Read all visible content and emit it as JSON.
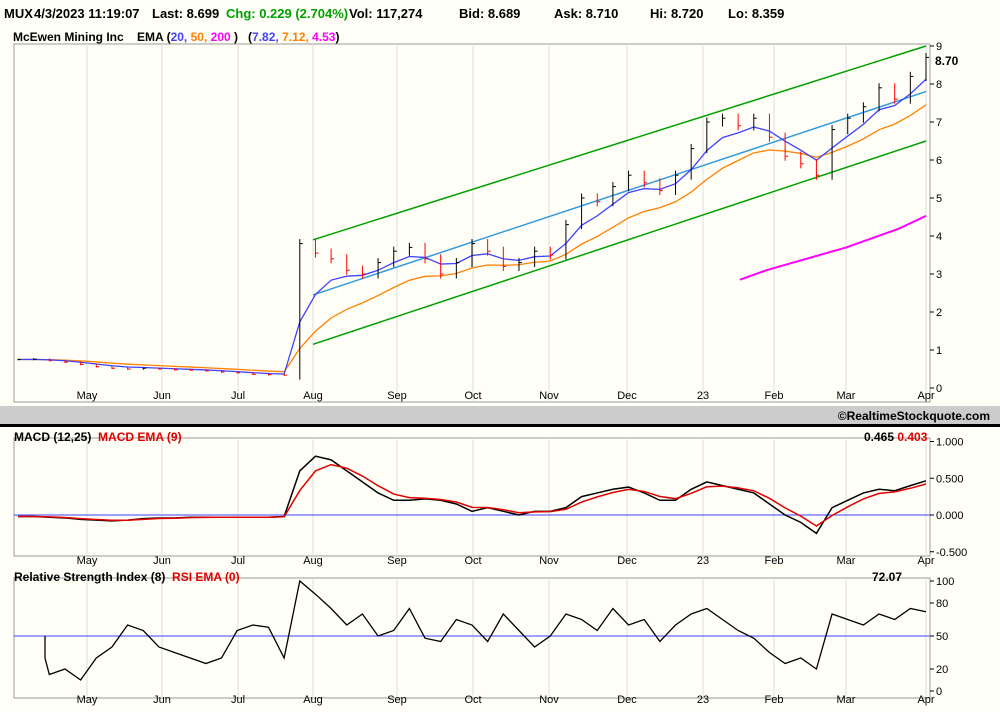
{
  "header": {
    "symbol": "MUX",
    "datetime": "4/3/2023 11:19:07",
    "last": "Last: 8.699",
    "chg": "Chg: 0.229 (2.704%)",
    "vol": "Vol: 117,274",
    "bid": "Bid: 8.689",
    "ask": "Ask: 8.710",
    "hi": "Hi: 8.720",
    "lo": "Lo: 8.359"
  },
  "price_panel": {
    "name": "McEwen Mining Inc",
    "ema_label": "EMA (",
    "ema_periods": [
      "20,",
      "50,",
      "200"
    ],
    "ema_close": ")",
    "ema_vals_open": "(",
    "ema_values": [
      "7.82,",
      "7.12,",
      "4.53"
    ],
    "ema_vals_close": ")",
    "last_tag": "8.70"
  },
  "copyright": "©RealtimeStockquote.com",
  "macd_panel": {
    "label": "MACD (12,25)",
    "signal_label": "MACD EMA (9)",
    "value": "0.465",
    "signal_value": "0.403"
  },
  "rsi_panel": {
    "label": "Relative Strength Index (8)",
    "ema_label": "RSI EMA (0)",
    "value": "72.07"
  },
  "colors": {
    "ema20": "#4040ff",
    "ema50": "#ff8000",
    "ema200": "#ff00ff",
    "channel": "#00a000",
    "midline": "#3399dd",
    "up": "#000000",
    "down": "#ff0000",
    "macd_signal": "#e00000"
  },
  "chart_data": [
    {
      "type": "line",
      "title": "McEwen Mining Inc",
      "ylabel": "Price",
      "ylim": [
        0,
        9
      ],
      "yticks": [
        "0",
        "1",
        "2",
        "3",
        "4",
        "5",
        "6",
        "7",
        "8",
        "9"
      ],
      "xticks": [
        "May",
        "Jun",
        "Jul",
        "Aug",
        "Sep",
        "Oct",
        "Nov",
        "Dec",
        "23",
        "Feb",
        "Mar",
        "Apr"
      ],
      "close": [
        0.75,
        0.76,
        0.72,
        0.68,
        0.62,
        0.56,
        0.52,
        0.5,
        0.52,
        0.5,
        0.48,
        0.47,
        0.45,
        0.42,
        0.4,
        0.36,
        0.35,
        0.34,
        3.8,
        3.55,
        3.4,
        3.1,
        3.0,
        3.3,
        3.6,
        3.7,
        3.4,
        3.0,
        3.3,
        3.8,
        3.6,
        3.2,
        3.3,
        3.6,
        3.5,
        4.3,
        5.0,
        4.9,
        5.3,
        5.6,
        5.4,
        5.2,
        5.6,
        6.3,
        7.0,
        7.1,
        6.9,
        7.1,
        6.6,
        6.1,
        5.9,
        5.6,
        6.8,
        7.1,
        7.4,
        7.9,
        7.6,
        8.2,
        8.7
      ],
      "ema200": [
        2.85,
        3.1,
        3.3,
        3.5,
        3.7,
        3.95,
        4.2,
        4.53
      ],
      "trendlines": [
        {
          "name": "upper-channel",
          "from": [
            "Aug",
            3.9
          ],
          "to": [
            "Apr",
            9.0
          ]
        },
        {
          "name": "mid-line",
          "from": [
            "Aug",
            2.45
          ],
          "to": [
            "Apr",
            7.8
          ]
        },
        {
          "name": "lower-channel",
          "from": [
            "Aug",
            1.15
          ],
          "to": [
            "Apr",
            6.5
          ]
        }
      ]
    },
    {
      "type": "line",
      "title": "MACD (12,25)",
      "ylim": [
        -0.5,
        1.0
      ],
      "yticks": [
        "1.000",
        "0.500",
        "0.000",
        "-0.500"
      ],
      "macd": [
        -0.02,
        -0.02,
        -0.03,
        -0.04,
        -0.06,
        -0.07,
        -0.08,
        -0.07,
        -0.05,
        -0.04,
        -0.04,
        -0.03,
        -0.03,
        -0.03,
        -0.03,
        -0.03,
        -0.03,
        -0.02,
        0.6,
        0.8,
        0.75,
        0.6,
        0.45,
        0.3,
        0.2,
        0.2,
        0.22,
        0.2,
        0.15,
        0.05,
        0.1,
        0.05,
        0.0,
        0.05,
        0.05,
        0.1,
        0.25,
        0.3,
        0.35,
        0.38,
        0.3,
        0.2,
        0.2,
        0.35,
        0.45,
        0.4,
        0.35,
        0.3,
        0.15,
        0.0,
        -0.1,
        -0.25,
        0.1,
        0.2,
        0.3,
        0.35,
        0.33,
        0.4,
        0.465
      ]
    },
    {
      "type": "line",
      "title": "Relative Strength Index (8)",
      "ylim": [
        0,
        100
      ],
      "yticks": [
        "100",
        "80",
        "50",
        "20",
        "0"
      ],
      "rsi": [
        50,
        30,
        15,
        20,
        10,
        30,
        40,
        60,
        55,
        40,
        35,
        30,
        25,
        30,
        55,
        60,
        58,
        30,
        100,
        88,
        75,
        60,
        70,
        50,
        55,
        75,
        48,
        45,
        65,
        60,
        45,
        70,
        55,
        40,
        50,
        70,
        65,
        55,
        75,
        60,
        65,
        45,
        60,
        70,
        75,
        65,
        55,
        48,
        35,
        25,
        30,
        20,
        70,
        65,
        60,
        70,
        65,
        75,
        72
      ]
    }
  ]
}
